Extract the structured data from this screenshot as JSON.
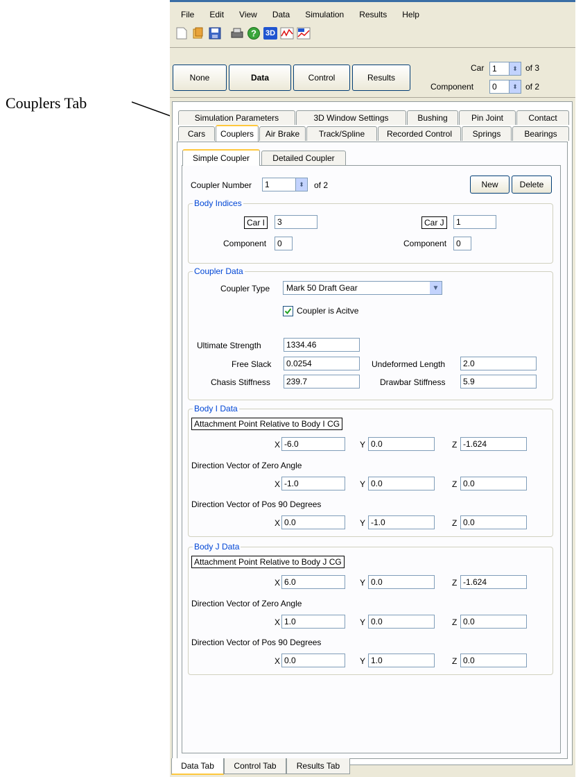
{
  "annotation": {
    "text": "Couplers Tab"
  },
  "menu": [
    "File",
    "Edit",
    "View",
    "Data",
    "Simulation",
    "Results",
    "Help"
  ],
  "toolbar_icons": [
    "new-file-icon",
    "open-file-icon",
    "save-icon",
    "print-icon",
    "help-icon",
    "3d-view-icon",
    "plot-icon",
    "3d-plot-icon"
  ],
  "toolbar_text": {
    "three_d": "3D"
  },
  "modes": {
    "none": "None",
    "data": "Data",
    "control": "Control",
    "results": "Results"
  },
  "selector": {
    "car_label": "Car",
    "car_value": "1",
    "car_of": "of 3",
    "component_label": "Component",
    "component_value": "0",
    "component_of": "of 2"
  },
  "tabs_row1": [
    "Simulation Parameters",
    "3D Window Settings",
    "Bushing",
    "Pin Joint",
    "Contact"
  ],
  "tabs_row2": [
    "Cars",
    "Couplers",
    "Air Brake",
    "Track/Spline",
    "Recorded Control",
    "Springs",
    "Bearings"
  ],
  "subtabs": [
    "Simple Coupler",
    "Detailed Coupler"
  ],
  "coupler": {
    "number_label": "Coupler Number",
    "number_value": "1",
    "number_of": "of 2",
    "new_label": "New",
    "delete_label": "Delete"
  },
  "body_indices": {
    "title": "Body Indices",
    "car_i_label": "Car I",
    "car_i_value": "3",
    "car_j_label": "Car J",
    "car_j_value": "1",
    "component_label": "Component",
    "component_i_value": "0",
    "component_j_value": "0"
  },
  "coupler_data": {
    "title": "Coupler Data",
    "type_label": "Coupler Type",
    "type_value": "Mark 50 Draft Gear",
    "active_label": "Coupler is Acitve",
    "active_checked": true,
    "ultimate_strength_label": "Ultimate Strength",
    "ultimate_strength": "1334.46",
    "free_slack_label": "Free Slack",
    "free_slack": "0.0254",
    "undeformed_length_label": "Undeformed Length",
    "undeformed_length": "2.0",
    "chasis_stiffness_label": "Chasis Stiffness",
    "chasis_stiffness": "239.7",
    "drawbar_stiffness_label": "Drawbar Stiffness",
    "drawbar_stiffness": "5.9"
  },
  "body_i": {
    "title": "Body I Data",
    "attach_label": "Attachment Point Relative to Body I CG",
    "attach": {
      "x": "-6.0",
      "y": "0.0",
      "z": "-1.624"
    },
    "zero_label": "Direction Vector of Zero Angle",
    "zero": {
      "x": "-1.0",
      "y": "0.0",
      "z": "0.0"
    },
    "pos90_label": "Direction Vector of Pos 90 Degrees",
    "pos90": {
      "x": "0.0",
      "y": "-1.0",
      "z": "0.0"
    }
  },
  "body_j": {
    "title": "Body J Data",
    "attach_label": "Attachment Point Relative to Body J CG",
    "attach": {
      "x": "6.0",
      "y": "0.0",
      "z": "-1.624"
    },
    "zero_label": "Direction Vector of Zero Angle",
    "zero": {
      "x": "1.0",
      "y": "0.0",
      "z": "0.0"
    },
    "pos90_label": "Direction Vector of Pos 90 Degrees",
    "pos90": {
      "x": "0.0",
      "y": "1.0",
      "z": "0.0"
    }
  },
  "axis_labels": {
    "x": "X",
    "y": "Y",
    "z": "Z"
  },
  "bottom_tabs": [
    "Data Tab",
    "Control Tab",
    "Results Tab"
  ]
}
